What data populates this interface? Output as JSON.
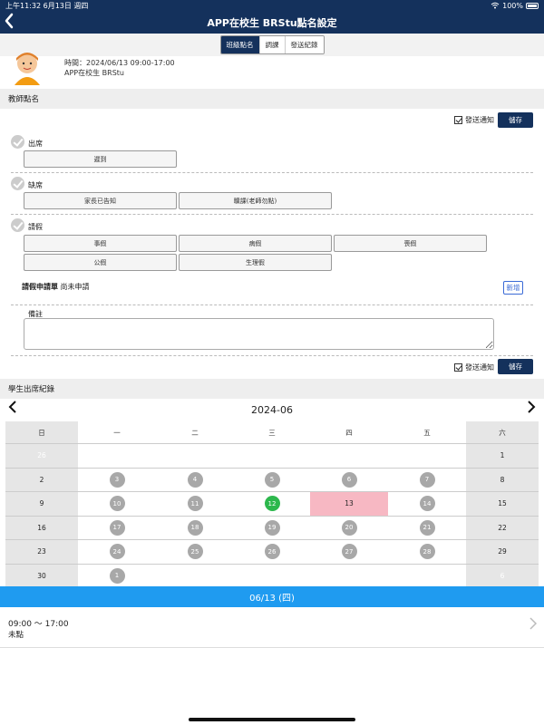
{
  "status": {
    "time": "上午11:32",
    "date": "6月13日 週四",
    "battery": "100%"
  },
  "nav": {
    "title": "APP在校生 BRStu點名設定"
  },
  "tabs": [
    "班級點名",
    "調課",
    "發送紀錄"
  ],
  "info": {
    "time_line": "時間：2024/06/13 09:00-17:00",
    "name_line": "APP在校生 BRStu"
  },
  "teacher_section": {
    "title": "教師點名"
  },
  "notify_label": "發送通知",
  "save_label": "儲存",
  "groups": {
    "present": {
      "label": "出席",
      "options": [
        "遲到"
      ]
    },
    "absent": {
      "label": "缺席",
      "options": [
        "家長已告知",
        "曠課(老師勿點)"
      ]
    },
    "leave": {
      "label": "請假",
      "options": [
        "事假",
        "病假",
        "喪假",
        "公假",
        "生理假"
      ]
    }
  },
  "leave_request": {
    "label": "請假申請單",
    "status": "尚未申請",
    "add_label": "新增"
  },
  "remark": {
    "label": "備註",
    "value": ""
  },
  "record_section": {
    "title": "學生出席紀錄"
  },
  "calendar": {
    "month": "2024-06",
    "weekdays": [
      "日",
      "一",
      "二",
      "三",
      "四",
      "五",
      "六"
    ],
    "weeks": [
      [
        "26",
        "",
        "",
        "",
        "",
        "",
        "1"
      ],
      [
        "2",
        "3",
        "4",
        "5",
        "6",
        "7",
        "8"
      ],
      [
        "9",
        "10",
        "11",
        "12",
        "13",
        "14",
        "15"
      ],
      [
        "16",
        "17",
        "18",
        "19",
        "20",
        "21",
        "22"
      ],
      [
        "23",
        "24",
        "25",
        "26",
        "27",
        "28",
        "29"
      ],
      [
        "30",
        "1",
        "",
        "",
        "",
        "",
        "6"
      ]
    ],
    "today": "12",
    "selected": "13"
  },
  "selected_date": "06/13 (四)",
  "session": {
    "time": "09:00 ～ 17:00",
    "status": "未點"
  }
}
